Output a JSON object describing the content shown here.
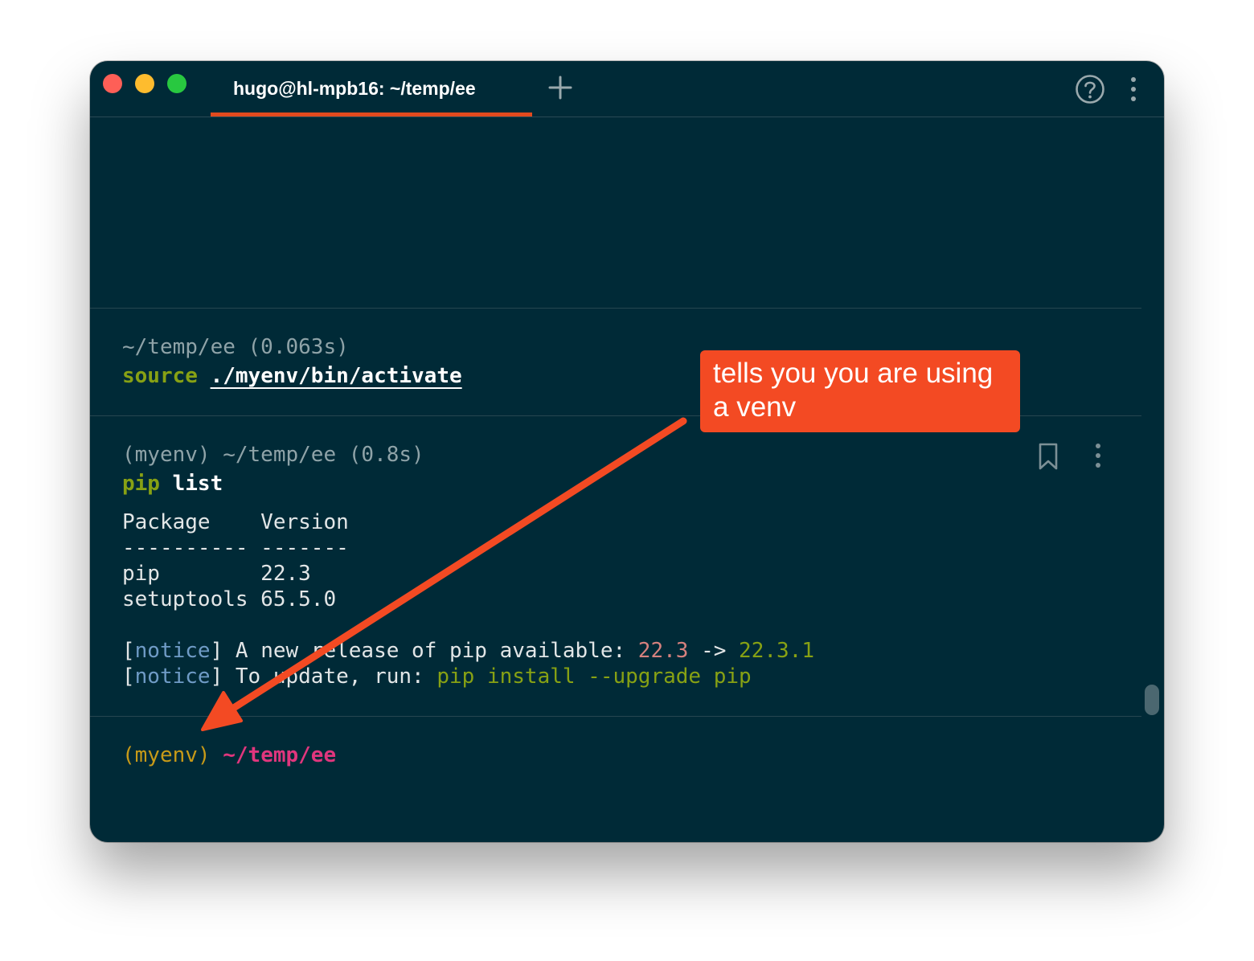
{
  "window": {
    "tab_title": "hugo@hl-mpb16: ~/temp/ee"
  },
  "blocks": [
    {
      "header": "~/temp/ee (0.063s)",
      "command_keyword": "source",
      "command_args": "./myenv/bin/activate"
    },
    {
      "header": "(myenv) ~/temp/ee (0.8s)",
      "command_keyword": "pip",
      "command_args": "list",
      "output": {
        "table_header": "Package    Version",
        "table_rule": "---------- -------",
        "rows": [
          "pip        22.3",
          "setuptools 65.5.0"
        ],
        "notice1": {
          "open": "[",
          "tag": "notice",
          "close": "]",
          "text": " A new release of pip available: ",
          "old_version": "22.3",
          "arrow": " -> ",
          "new_version": "22.3.1"
        },
        "notice2": {
          "open": "[",
          "tag": "notice",
          "close": "]",
          "text": " To update, run: ",
          "command": "pip install --upgrade pip"
        }
      }
    }
  ],
  "prompt": {
    "env": "(myenv)",
    "path": "~/temp/ee"
  },
  "annotation": {
    "text": "tells you you are using a venv",
    "color": "#f34a23"
  },
  "colors": {
    "background": "#002a37",
    "tab_underline": "#e24a1e",
    "keyword_green": "#87a114",
    "prompt_env": "#c79a18",
    "prompt_path": "#e0367d"
  },
  "icons": {
    "new_tab": "plus-icon",
    "help": "help-circle-icon",
    "menu": "kebab-menu-icon",
    "bookmark": "bookmark-icon"
  }
}
